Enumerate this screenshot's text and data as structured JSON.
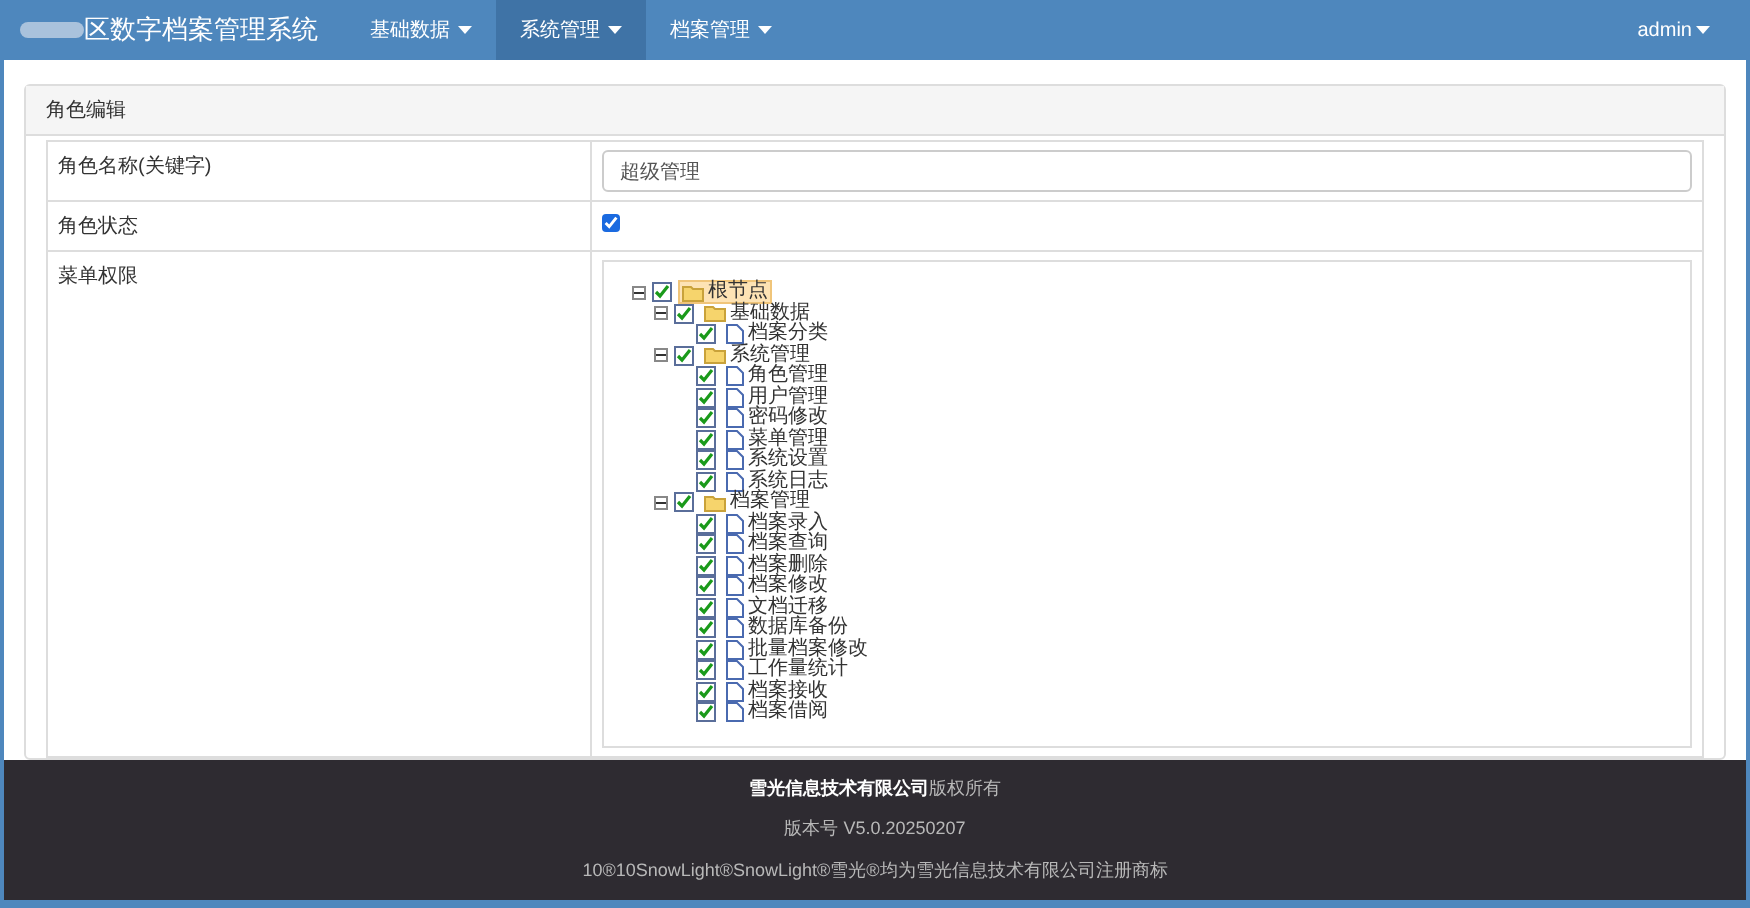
{
  "navbar": {
    "title": "区数字档案管理系统",
    "menus": [
      {
        "label": "基础数据",
        "selected": false
      },
      {
        "label": "系统管理",
        "selected": true
      },
      {
        "label": "档案管理",
        "selected": false
      }
    ],
    "user": "admin"
  },
  "panel": {
    "title": "角色编辑",
    "fields": [
      {
        "kind": "text",
        "label": "角色名称(关键字)",
        "value": "超级管理"
      },
      {
        "kind": "checkbox",
        "label": "角色状态",
        "checked": true
      },
      {
        "kind": "tree",
        "label": "菜单权限"
      }
    ]
  },
  "tree": [
    {
      "label": "根节点",
      "kind": "folder",
      "checked": true,
      "expanded": true,
      "selected": true,
      "children": [
        {
          "label": "基础数据",
          "kind": "folder",
          "checked": true,
          "expanded": true,
          "selected": false,
          "children": [
            {
              "label": "档案分类",
              "kind": "file",
              "checked": true,
              "selected": false
            }
          ]
        },
        {
          "label": "系统管理",
          "kind": "folder",
          "checked": true,
          "expanded": true,
          "selected": false,
          "children": [
            {
              "label": "角色管理",
              "kind": "file",
              "checked": true,
              "selected": false
            },
            {
              "label": "用户管理",
              "kind": "file",
              "checked": true,
              "selected": false
            },
            {
              "label": "密码修改",
              "kind": "file",
              "checked": true,
              "selected": false
            },
            {
              "label": "菜单管理",
              "kind": "file",
              "checked": true,
              "selected": false
            },
            {
              "label": "系统设置",
              "kind": "file",
              "checked": true,
              "selected": false
            },
            {
              "label": "系统日志",
              "kind": "file",
              "checked": true,
              "selected": false
            }
          ]
        },
        {
          "label": "档案管理",
          "kind": "folder",
          "checked": true,
          "expanded": true,
          "selected": false,
          "children": [
            {
              "label": "档案录入",
              "kind": "file",
              "checked": true,
              "selected": false
            },
            {
              "label": "档案查询",
              "kind": "file",
              "checked": true,
              "selected": false
            },
            {
              "label": "档案删除",
              "kind": "file",
              "checked": true,
              "selected": false
            },
            {
              "label": "档案修改",
              "kind": "file",
              "checked": true,
              "selected": false
            },
            {
              "label": "文档迁移",
              "kind": "file",
              "checked": true,
              "selected": false
            },
            {
              "label": "数据库备份",
              "kind": "file",
              "checked": true,
              "selected": false
            },
            {
              "label": "批量档案修改",
              "kind": "file",
              "checked": true,
              "selected": false
            },
            {
              "label": "工作量统计",
              "kind": "file",
              "checked": true,
              "selected": false
            },
            {
              "label": "档案接收",
              "kind": "file",
              "checked": true,
              "selected": false
            },
            {
              "label": "档案借阅",
              "kind": "file",
              "checked": true,
              "selected": false
            }
          ]
        }
      ]
    }
  ],
  "footer": {
    "lines": [
      "**雪光信息技术有限公司**版权所有",
      "版本号 V5.0.20250207",
      "10®10SnowLight®SnowLight®雪光®均为雪光信息技术有限公司注册商标"
    ]
  }
}
